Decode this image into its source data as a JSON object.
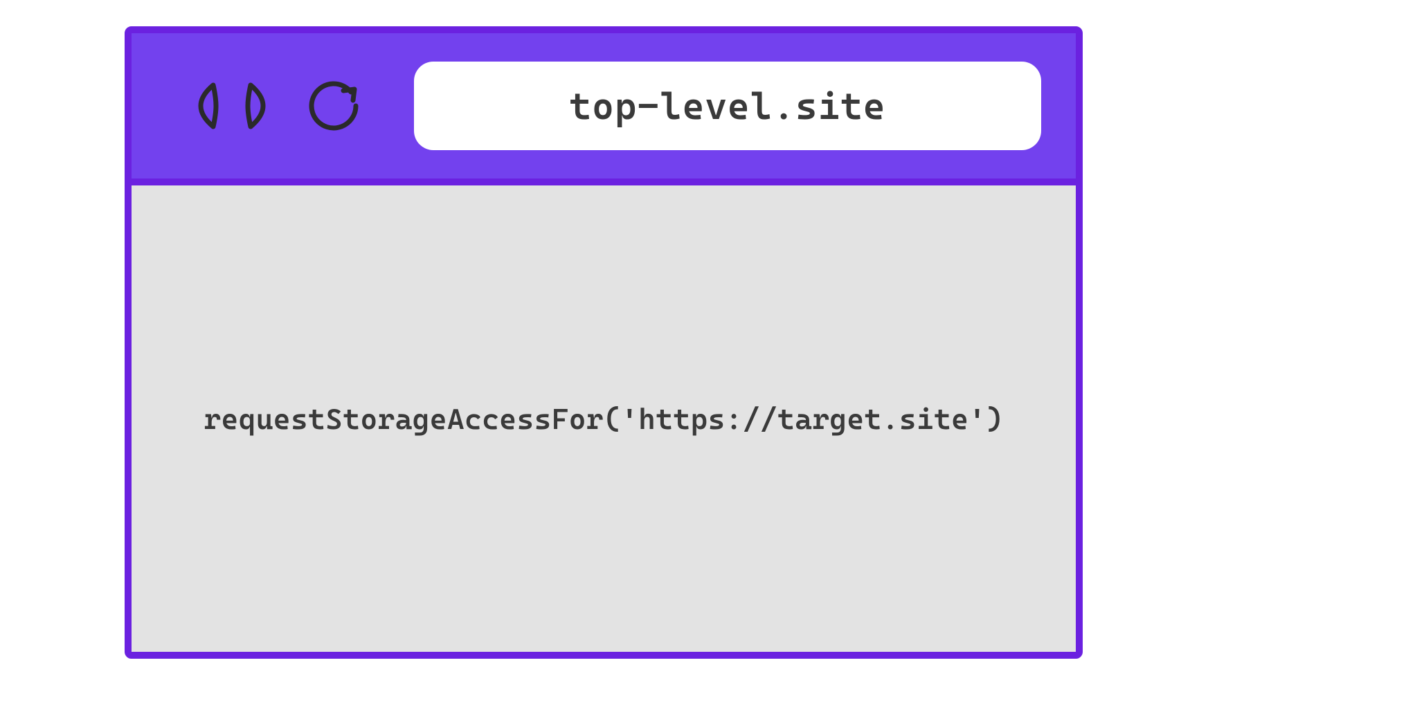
{
  "browser": {
    "address_bar": "top-level.site",
    "content_code": "requestStorageAccessFor('https://target.site')"
  },
  "colors": {
    "toolbar_bg": "#7341ee",
    "border": "#6b21e0",
    "content_bg": "#e3e3e3",
    "text": "#3a3a3a"
  }
}
